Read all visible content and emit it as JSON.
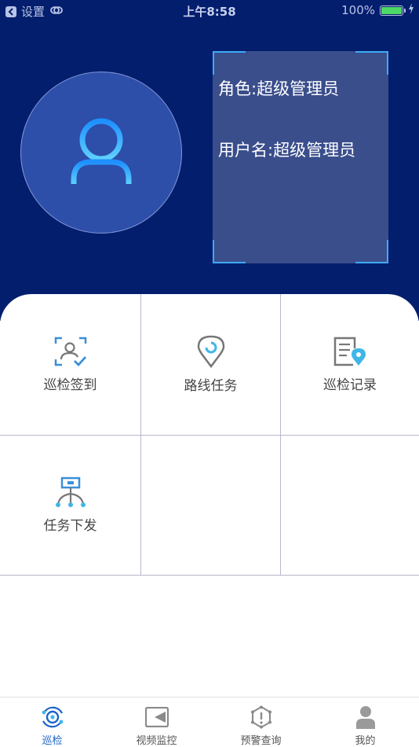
{
  "status_bar": {
    "back_app": "设置",
    "time": "上午8:58",
    "battery": "100%"
  },
  "profile": {
    "role_text": "角色:超级管理员",
    "username_text": "用户名:超级管理员"
  },
  "grid": {
    "items": [
      {
        "label": "巡检签到",
        "icon": "check-in-icon"
      },
      {
        "label": "路线任务",
        "icon": "location-pin-icon"
      },
      {
        "label": "巡检记录",
        "icon": "record-icon"
      },
      {
        "label": "任务下发",
        "icon": "dispatch-icon"
      }
    ]
  },
  "tabbar": {
    "tabs": [
      {
        "label": "巡检",
        "icon": "patrol-icon",
        "active": true
      },
      {
        "label": "视频监控",
        "icon": "video-camera-icon",
        "active": false
      },
      {
        "label": "预警查询",
        "icon": "warning-icon",
        "active": false
      },
      {
        "label": "我的",
        "icon": "person-icon",
        "active": false
      }
    ]
  },
  "colors": {
    "header_bg": "#041e6e",
    "accent": "#3fa9f5",
    "active_tab": "#1a62c9"
  }
}
